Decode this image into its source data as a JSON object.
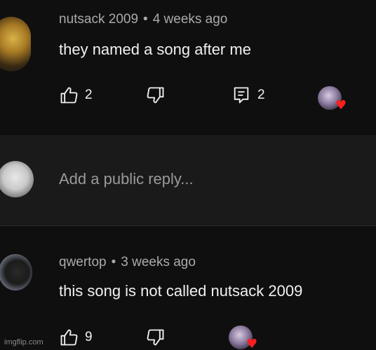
{
  "comments": [
    {
      "author": "nutsack 2009",
      "time": "4 weeks ago",
      "text": "they named a song after me",
      "likes": "2",
      "replies": "2"
    },
    {
      "author": "qwertop",
      "time": "3 weeks ago",
      "text": "this song is not called nutsack 2009",
      "likes": "9"
    }
  ],
  "separator": "•",
  "reply": {
    "placeholder": "Add a public reply..."
  },
  "watermark": "imgflip.com",
  "colors": {
    "background": "#0f0f0f",
    "reply_background": "#1a1a1a",
    "text_primary": "#f1f1f1",
    "text_secondary": "#aaaaaa",
    "heart": "#ff1e1e"
  },
  "icons": {
    "like": "thumbs-up-icon",
    "dislike": "thumbs-down-icon",
    "reply": "reply-icon",
    "heart": "heart-icon"
  }
}
